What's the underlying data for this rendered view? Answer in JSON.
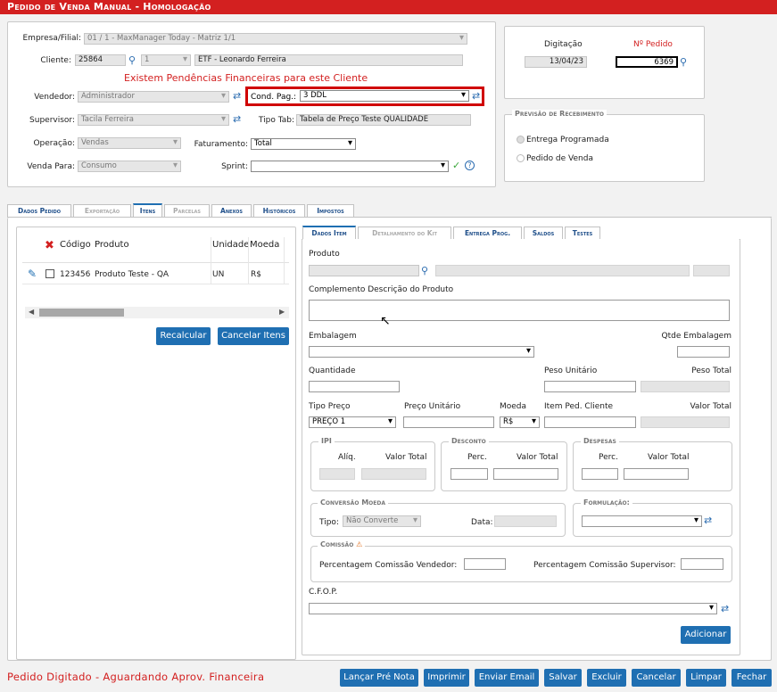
{
  "title": "Pedido de Venda Manual - Homologação",
  "header": {
    "empresa_label": "Empresa/Filial:",
    "empresa_value": "01 / 1 - MaxManager Today - Matriz 1/1",
    "cliente_label": "Cliente:",
    "cliente_code": "25864",
    "cliente_seq": "1",
    "cliente_name": "ETF - Leonardo Ferreira",
    "pendencias": "Existem Pendências Financeiras para este Cliente",
    "vendedor_label": "Vendedor:",
    "vendedor_value": "Administrador",
    "condpag_label": "Cond. Pag.:",
    "condpag_value": "3 DDL",
    "supervisor_label": "Supervisor:",
    "supervisor_value": "Tacila Ferreira",
    "tipotab_label": "Tipo Tab:",
    "tipotab_value": "Tabela de Preço Teste QUALIDADE",
    "operacao_label": "Operação:",
    "operacao_value": "Vendas",
    "faturamento_label": "Faturamento:",
    "faturamento_value": "Total",
    "vendapara_label": "Venda Para:",
    "vendapara_value": "Consumo",
    "sprint_label": "Sprint:",
    "sprint_value": ""
  },
  "digitacao": {
    "label": "Digitação",
    "value": "13/04/23",
    "npedido_label": "Nº Pedido",
    "npedido_value": "6369"
  },
  "previsao": {
    "title": "Previsão de Recebimento",
    "opt1": "Entrega Programada",
    "opt2": "Pedido de Venda"
  },
  "main_tabs": [
    "Dados Pedido",
    "Exportação",
    "Itens",
    "Parcelas",
    "Anexos",
    "Históricos",
    "Impostos"
  ],
  "items_table": {
    "headers": [
      "Código",
      "Produto",
      "Unidade",
      "Moeda"
    ],
    "rows": [
      {
        "codigo": "123456",
        "produto": "Produto Teste - QA",
        "unidade": "UN",
        "moeda": "R$"
      }
    ]
  },
  "left_buttons": {
    "recalcular": "Recalcular",
    "cancelar_itens": "Cancelar Itens"
  },
  "item_tabs": [
    "Dados Item",
    "Detalhamento do Kit",
    "Entrega Prog.",
    "Saldos",
    "Testes"
  ],
  "item": {
    "produto": "Produto",
    "complemento": "Complemento Descrição do Produto",
    "embalagem": "Embalagem",
    "qtde_embalagem": "Qtde Embalagem",
    "quantidade": "Quantidade",
    "peso_unitario": "Peso Unitário",
    "peso_total": "Peso Total",
    "tipo_preco": "Tipo Preço",
    "tipo_preco_value": "PREÇO 1",
    "preco_unitario": "Preço Unitário",
    "moeda": "Moeda",
    "moeda_value": "R$",
    "item_ped_cliente": "Item Ped. Cliente",
    "valor_total": "Valor Total",
    "ipi": "IPI",
    "aliq": "Alíq.",
    "ipi_valor_total": "Valor Total",
    "desconto": "Desconto",
    "desc_perc": "Perc.",
    "desc_valor_total": "Valor Total",
    "despesas": "Despesas",
    "desp_perc": "Perc.",
    "desp_valor_total": "Valor Total",
    "conversao": "Conversão Moeda",
    "tipo": "Tipo:",
    "tipo_value": "Não Converte",
    "data": "Data:",
    "formulacao": "Formulação:",
    "comissao": "Comissão",
    "perc_vendedor": "Percentagem Comissão Vendedor:",
    "perc_supervisor": "Percentagem Comissão Supervisor:",
    "cfop": "C.F.O.P.",
    "adicionar": "Adicionar"
  },
  "status": "Pedido Digitado - Aguardando Aprov. Financeira",
  "footer_buttons": [
    "Lançar Pré Nota",
    "Imprimir",
    "Enviar Email",
    "Salvar",
    "Excluir",
    "Cancelar",
    "Limpar",
    "Fechar"
  ],
  "colors": {
    "titlebar": "#d32020",
    "button": "#1f6fb2",
    "highlight": "#d00000",
    "status": "#d32020"
  }
}
